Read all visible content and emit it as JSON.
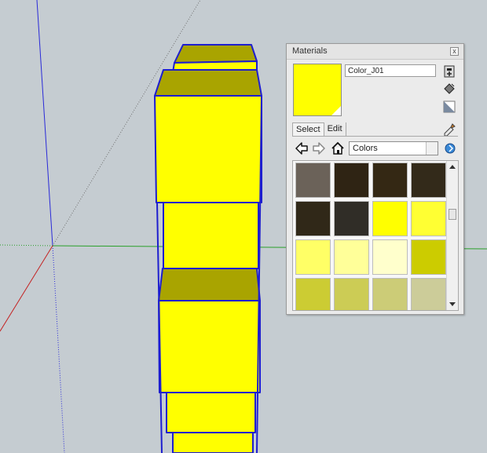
{
  "colors": {
    "face_top": "#a9a400",
    "face_front": "#ffff00",
    "edge": "#1e1ecf",
    "background": "#c5ccd1",
    "axis_blue": "#2a2ad8",
    "axis_green": "#2aa02a",
    "axis_red": "#c42222"
  },
  "materials": {
    "title": "Materials",
    "close_label": "x",
    "material_name": "Color_J01",
    "preview_color": "#ffff00",
    "tabs": [
      {
        "label": "Select",
        "active": true
      },
      {
        "label": "Edit",
        "active": false
      }
    ],
    "category": "Colors",
    "icons": [
      "create-material-icon",
      "paint-bucket-icon",
      "default-material-icon",
      "sample-paint-icon",
      "back-arrow-icon",
      "forward-arrow-icon",
      "home-icon",
      "details-arrow-icon"
    ],
    "swatches": [
      "#6b6259",
      "#2f2414",
      "#342814",
      "#332a1a",
      "#302818",
      "#302d27",
      "#ffff00",
      "#ffff33",
      "#ffff66",
      "#ffff99",
      "#ffffcc",
      "#cccc00",
      "#cccc33",
      "#cccc55",
      "#cccc77",
      "#cccc99"
    ]
  }
}
